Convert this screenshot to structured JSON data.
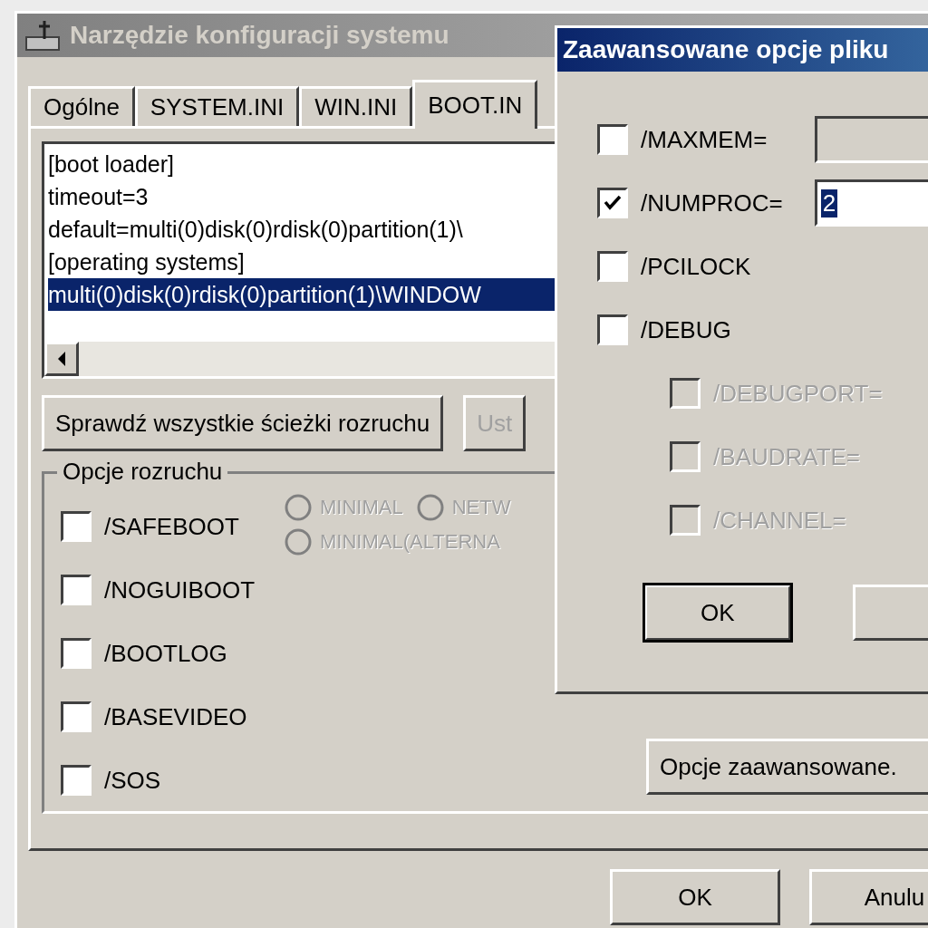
{
  "main_window": {
    "title": "Narzędzie konfiguracji systemu",
    "tabs": [
      {
        "label": "Ogólne",
        "selected": false
      },
      {
        "label": "SYSTEM.INI",
        "selected": false
      },
      {
        "label": "WIN.INI",
        "selected": false
      },
      {
        "label": "BOOT.IN",
        "selected": true
      }
    ],
    "boot_ini_lines": [
      {
        "text": "[boot loader]",
        "selected": false
      },
      {
        "text": "timeout=3",
        "selected": false
      },
      {
        "text": "default=multi(0)disk(0)rdisk(0)partition(1)\\",
        "selected": false
      },
      {
        "text": "[operating systems]",
        "selected": false
      },
      {
        "text": "multi(0)disk(0)rdisk(0)partition(1)\\WINDOW",
        "selected": true
      }
    ],
    "buttons": [
      {
        "label": "Sprawdź wszystkie ścieżki rozruchu",
        "disabled": false
      },
      {
        "label": "Ust",
        "disabled": true
      }
    ],
    "boot_options": {
      "title": "Opcje rozruchu",
      "checkboxes": [
        {
          "label": "/SAFEBOOT",
          "checked": false
        },
        {
          "label": "/NOGUIBOOT",
          "checked": false
        },
        {
          "label": "/BOOTLOG",
          "checked": false
        },
        {
          "label": "/BASEVIDEO",
          "checked": false
        },
        {
          "label": "/SOS",
          "checked": false
        }
      ],
      "radios": [
        {
          "label": "MINIMAL",
          "selected": false,
          "disabled": true
        },
        {
          "label": "NETW",
          "selected": false,
          "disabled": true
        },
        {
          "label": "MINIMAL(ALTERNA",
          "selected": false,
          "disabled": true
        }
      ],
      "advanced_button": "Opcje zaawansowane."
    },
    "footer_buttons": [
      "OK",
      "Anulu"
    ]
  },
  "dialog": {
    "title": "Zaawansowane opcje pliku",
    "options": [
      {
        "kind": "field",
        "label": "/MAXMEM=",
        "checked": false,
        "disabled": false
      },
      {
        "kind": "field",
        "label": "/NUMPROC=",
        "checked": true,
        "disabled": false,
        "value": "2",
        "value_selected": true
      },
      {
        "kind": "plain",
        "label": "/PCILOCK",
        "checked": false,
        "disabled": false
      },
      {
        "kind": "plain",
        "label": "/DEBUG",
        "checked": false,
        "disabled": false
      },
      {
        "kind": "sub",
        "label": "/DEBUGPORT=",
        "checked": false,
        "disabled": true
      },
      {
        "kind": "sub",
        "label": "/BAUDRATE=",
        "checked": false,
        "disabled": true
      },
      {
        "kind": "sub",
        "label": "/CHANNEL=",
        "checked": false,
        "disabled": true
      }
    ],
    "buttons": [
      "OK"
    ]
  }
}
